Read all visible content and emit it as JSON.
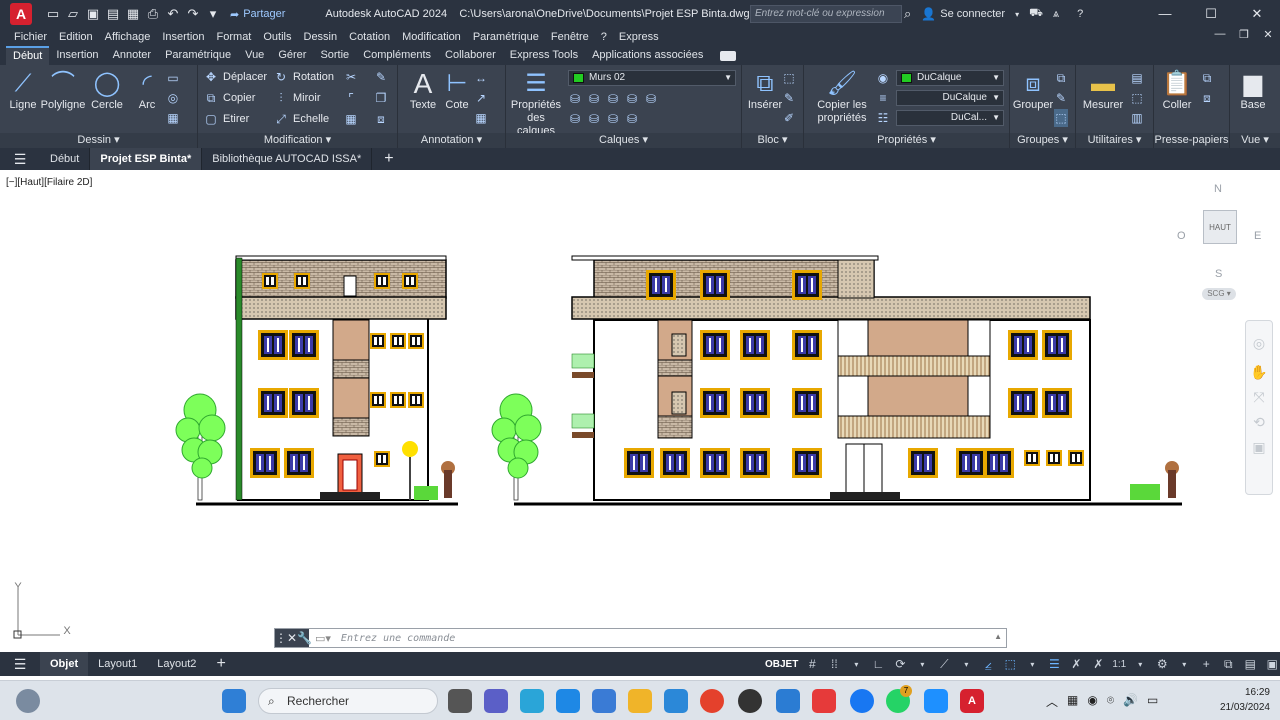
{
  "app": {
    "title": "Autodesk AutoCAD 2024",
    "file_path": "C:\\Users\\arona\\OneDrive\\Documents\\Projet ESP Binta.dwg",
    "share_label": "Partager",
    "search_placeholder": "Entrez mot-clé ou expression",
    "sign_in": "Se connecter"
  },
  "menu": [
    "Fichier",
    "Edition",
    "Affichage",
    "Insertion",
    "Format",
    "Outils",
    "Dessin",
    "Cotation",
    "Modification",
    "Paramétrique",
    "Fenêtre",
    "?",
    "Express"
  ],
  "ribbon_tabs": [
    "Début",
    "Insertion",
    "Annoter",
    "Paramétrique",
    "Vue",
    "Gérer",
    "Sortie",
    "Compléments",
    "Collaborer",
    "Express Tools",
    "Applications associées"
  ],
  "ribbon": {
    "dessin": {
      "title": "Dessin",
      "ligne": "Ligne",
      "polyligne": "Polyligne",
      "cercle": "Cercle",
      "arc": "Arc"
    },
    "modification": {
      "title": "Modification",
      "deplacer": "Déplacer",
      "rotation": "Rotation",
      "copier": "Copier",
      "miroir": "Miroir",
      "etirer": "Etirer",
      "echelle": "Echelle"
    },
    "annotation": {
      "title": "Annotation",
      "texte": "Texte",
      "cote": "Cote"
    },
    "calques": {
      "title": "Calques",
      "proprietes": "Propriétés des calques",
      "current_layer": "Murs 02"
    },
    "bloc": {
      "title": "Bloc",
      "inserer": "Insérer"
    },
    "proprietes": {
      "title": "Propriétés",
      "copier": "Copier les propriétés",
      "color": "DuCalque",
      "linetype": "DuCalque",
      "lineweight": "DuCal..."
    },
    "groupes": {
      "title": "Groupes",
      "grouper": "Grouper"
    },
    "utilitaires": {
      "title": "Utilitaires",
      "mesurer": "Mesurer"
    },
    "presse_papiers": {
      "title": "Presse-papiers",
      "coller": "Coller"
    },
    "vue": {
      "title": "Vue",
      "base": "Base"
    }
  },
  "doc_tabs": [
    "Début",
    "Projet ESP Binta*",
    "Bibliothèque AUTOCAD ISSA*"
  ],
  "viewport": {
    "label": "[−][Haut][Filaire 2D]",
    "viewcube": {
      "n": "N",
      "s": "S",
      "e": "E",
      "w": "O",
      "face": "HAUT",
      "wcs": "SCG"
    },
    "ucs_y": "Y",
    "ucs_x": "X"
  },
  "command": {
    "placeholder": "Entrez une commande"
  },
  "layouts": [
    "Objet",
    "Layout1",
    "Layout2"
  ],
  "status": {
    "model": "OBJET",
    "scale": "1:1"
  },
  "taskbar": {
    "search": "Rechercher",
    "time": "16:29",
    "date": "21/03/2024",
    "badge": "7"
  },
  "colors": {
    "accent": "#5aa0e6",
    "dark_ui": "#2b3340",
    "ribbon": "#3b4350",
    "layer_green": "#22cc22"
  }
}
